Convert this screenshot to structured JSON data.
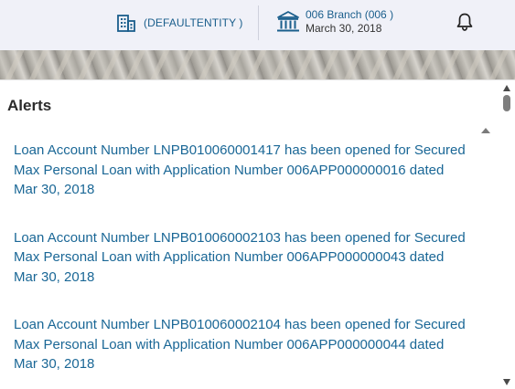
{
  "header": {
    "entity_label": "(DEFAULTENTITY )",
    "branch_name": "006 Branch (006 )",
    "branch_date": "March 30, 2018",
    "entity_icon": "building-icon",
    "branch_icon": "bank-icon",
    "notification_icon": "bell-icon"
  },
  "alerts": {
    "title": "Alerts",
    "items": [
      {
        "text": "Loan Account Number LNPB010060001417 has been opened for Secured Max Personal Loan with Application Number 006APP000000016 dated Mar 30, 2018"
      },
      {
        "text": "Loan Account Number LNPB010060002103 has been opened for Secured Max Personal Loan with Application Number 006APP000000043 dated Mar 30, 2018"
      },
      {
        "text": "Loan Account Number LNPB010060002104 has been opened for Secured Max Personal Loan with Application Number 006APP000000044 dated Mar 30, 2018"
      }
    ]
  },
  "colors": {
    "link": "#1a6796",
    "header_bg": "#f0f1f8",
    "accent": "#1a5e8c"
  }
}
